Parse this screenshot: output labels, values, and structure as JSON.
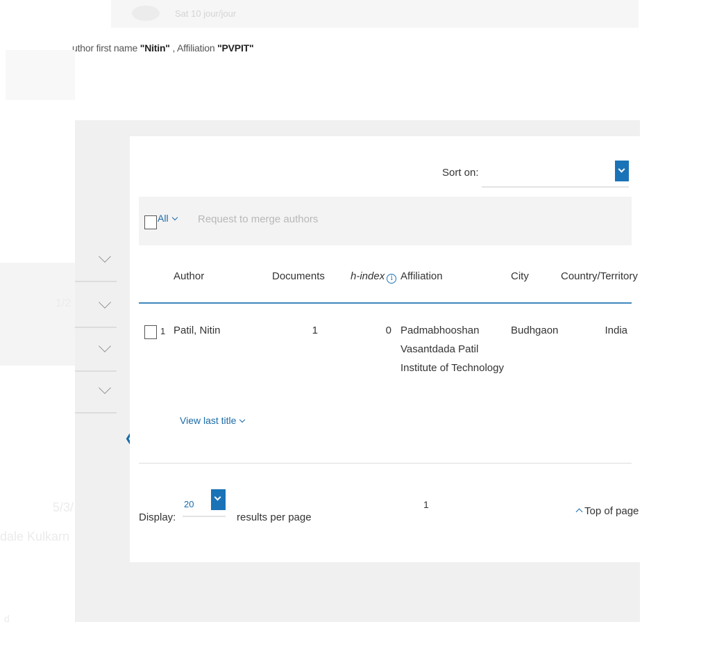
{
  "header": {
    "faded_text": "Sat 10 jour/jour"
  },
  "query": {
    "prefix": "uthor first name ",
    "first_name_value": "\"Nitin\"",
    "separator": " , Affiliation ",
    "affiliation_value": "\"PVPIT\""
  },
  "background_fragments": {
    "left_one": "1/2",
    "left_two": "5/3/",
    "left_three": "dale Kulkarn",
    "left_four": "d"
  },
  "sort": {
    "label": "Sort on:",
    "selected": ""
  },
  "actions": {
    "select_all_label": "All",
    "merge_label": "Request to merge authors"
  },
  "table": {
    "columns": [
      "Author",
      "Documents",
      "h-index",
      "Affiliation",
      "City",
      "Country/Territory"
    ],
    "rows": [
      {
        "index": "1",
        "author": "Patil, Nitin",
        "documents": "1",
        "h_index": "0",
        "affiliation": "Padmabhooshan Vasantdada Patil Institute of Technology",
        "city": "Budhgaon",
        "country": "India"
      }
    ],
    "view_last_title": "View last title"
  },
  "pagination": {
    "display_label": "Display:",
    "per_page_value": "20",
    "per_page_suffix": "results per page",
    "current_page": "1",
    "top_of_page": "Top of page"
  },
  "icons": {
    "collapse": "double-chevron-left-icon",
    "info": "info-icon",
    "dropdown": "chevron-down-icon"
  },
  "colors": {
    "accent": "#1a73b7",
    "link": "#1a6aa8",
    "panel": "#f0f0f0"
  }
}
